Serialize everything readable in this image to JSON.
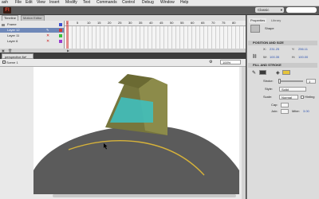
{
  "menu": {
    "app": "ash",
    "items": [
      "File",
      "Edit",
      "View",
      "Insert",
      "Modify",
      "Text",
      "Commands",
      "Control",
      "Debug",
      "Window",
      "Help"
    ]
  },
  "appbar": {
    "logo": "Fl",
    "workspace": "Classic",
    "workspace_arrow": "▾"
  },
  "timeline": {
    "tabs": [
      "Timeline",
      "Motion Editor"
    ],
    "layers": [
      {
        "name": "Frame",
        "selected": false,
        "color": "#3a4fd0"
      },
      {
        "name": "Layer 12",
        "selected": true,
        "color": "#d03a3a"
      },
      {
        "name": "Layer 11",
        "selected": false,
        "color": "#3ac03a"
      },
      {
        "name": "Layer 6",
        "selected": false,
        "color": "#9a3ad0"
      }
    ],
    "frame_numbers": [
      "1",
      "5",
      "10",
      "15",
      "20",
      "25",
      "30",
      "35",
      "40",
      "45",
      "50",
      "55",
      "60",
      "65",
      "70",
      "75",
      "80"
    ]
  },
  "document": {
    "tab": "perspective.fla*",
    "scene": "Scene 1",
    "zoom": "100%"
  },
  "properties": {
    "tabs": [
      "Properties",
      "Library"
    ],
    "object": "Shape",
    "sections": {
      "position": "POSITION AND SIZE",
      "fill": "FILL AND STROKE"
    },
    "x_label": "X:",
    "x_value": "231.25",
    "y_label": "Y:",
    "y_value": "256.11",
    "w_label": "W:",
    "w_value": "100.35",
    "h_label": "H:",
    "h_value": "100.00",
    "stroke_label": "Stroke:",
    "stroke_value": "1",
    "style_label": "Style:",
    "style_value": "Solid",
    "scale_label": "Scale:",
    "scale_value": "Normal",
    "hinting_label": "Hinting",
    "cap_label": "Cap:",
    "join_label": "Join:",
    "miter_label": "Miter:",
    "miter_value": "3.00",
    "stroke_color": "#3a3a3a",
    "fill_color": "#e6c43a"
  },
  "artwork": {
    "ground_color": "#5b5b5b",
    "box_face_color": "#8c8b4a",
    "box_top_color": "#6b6a33",
    "box_side_color": "#77763d",
    "glass_color": "#3fbfbd",
    "line_color": "#d6b23a"
  }
}
